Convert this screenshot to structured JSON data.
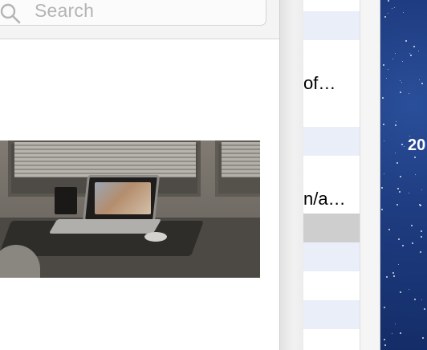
{
  "search": {
    "placeholder": "Search",
    "icon": "search-icon"
  },
  "hero_image": {
    "description_icon": "desk-photo"
  },
  "list": {
    "rows": [
      {
        "label": "",
        "style": "alt"
      },
      {
        "label": "",
        "style": "plain"
      },
      {
        "label": "of…",
        "style": "plain"
      },
      {
        "label": "",
        "style": "plain"
      },
      {
        "label": "",
        "style": "alt"
      },
      {
        "label": "",
        "style": "plain"
      },
      {
        "label": "n/a…",
        "style": "plain"
      },
      {
        "label": "",
        "style": "selected"
      },
      {
        "label": "",
        "style": "alt"
      },
      {
        "label": "",
        "style": "plain"
      },
      {
        "label": "",
        "style": "alt"
      },
      {
        "label": "",
        "style": "plain"
      }
    ]
  },
  "wallpaper": {
    "visible_text": "20"
  },
  "colors": {
    "row_alt": "#e9eef9",
    "row_selected": "#cecece",
    "wallpaper_blue": "#1f3d82"
  }
}
